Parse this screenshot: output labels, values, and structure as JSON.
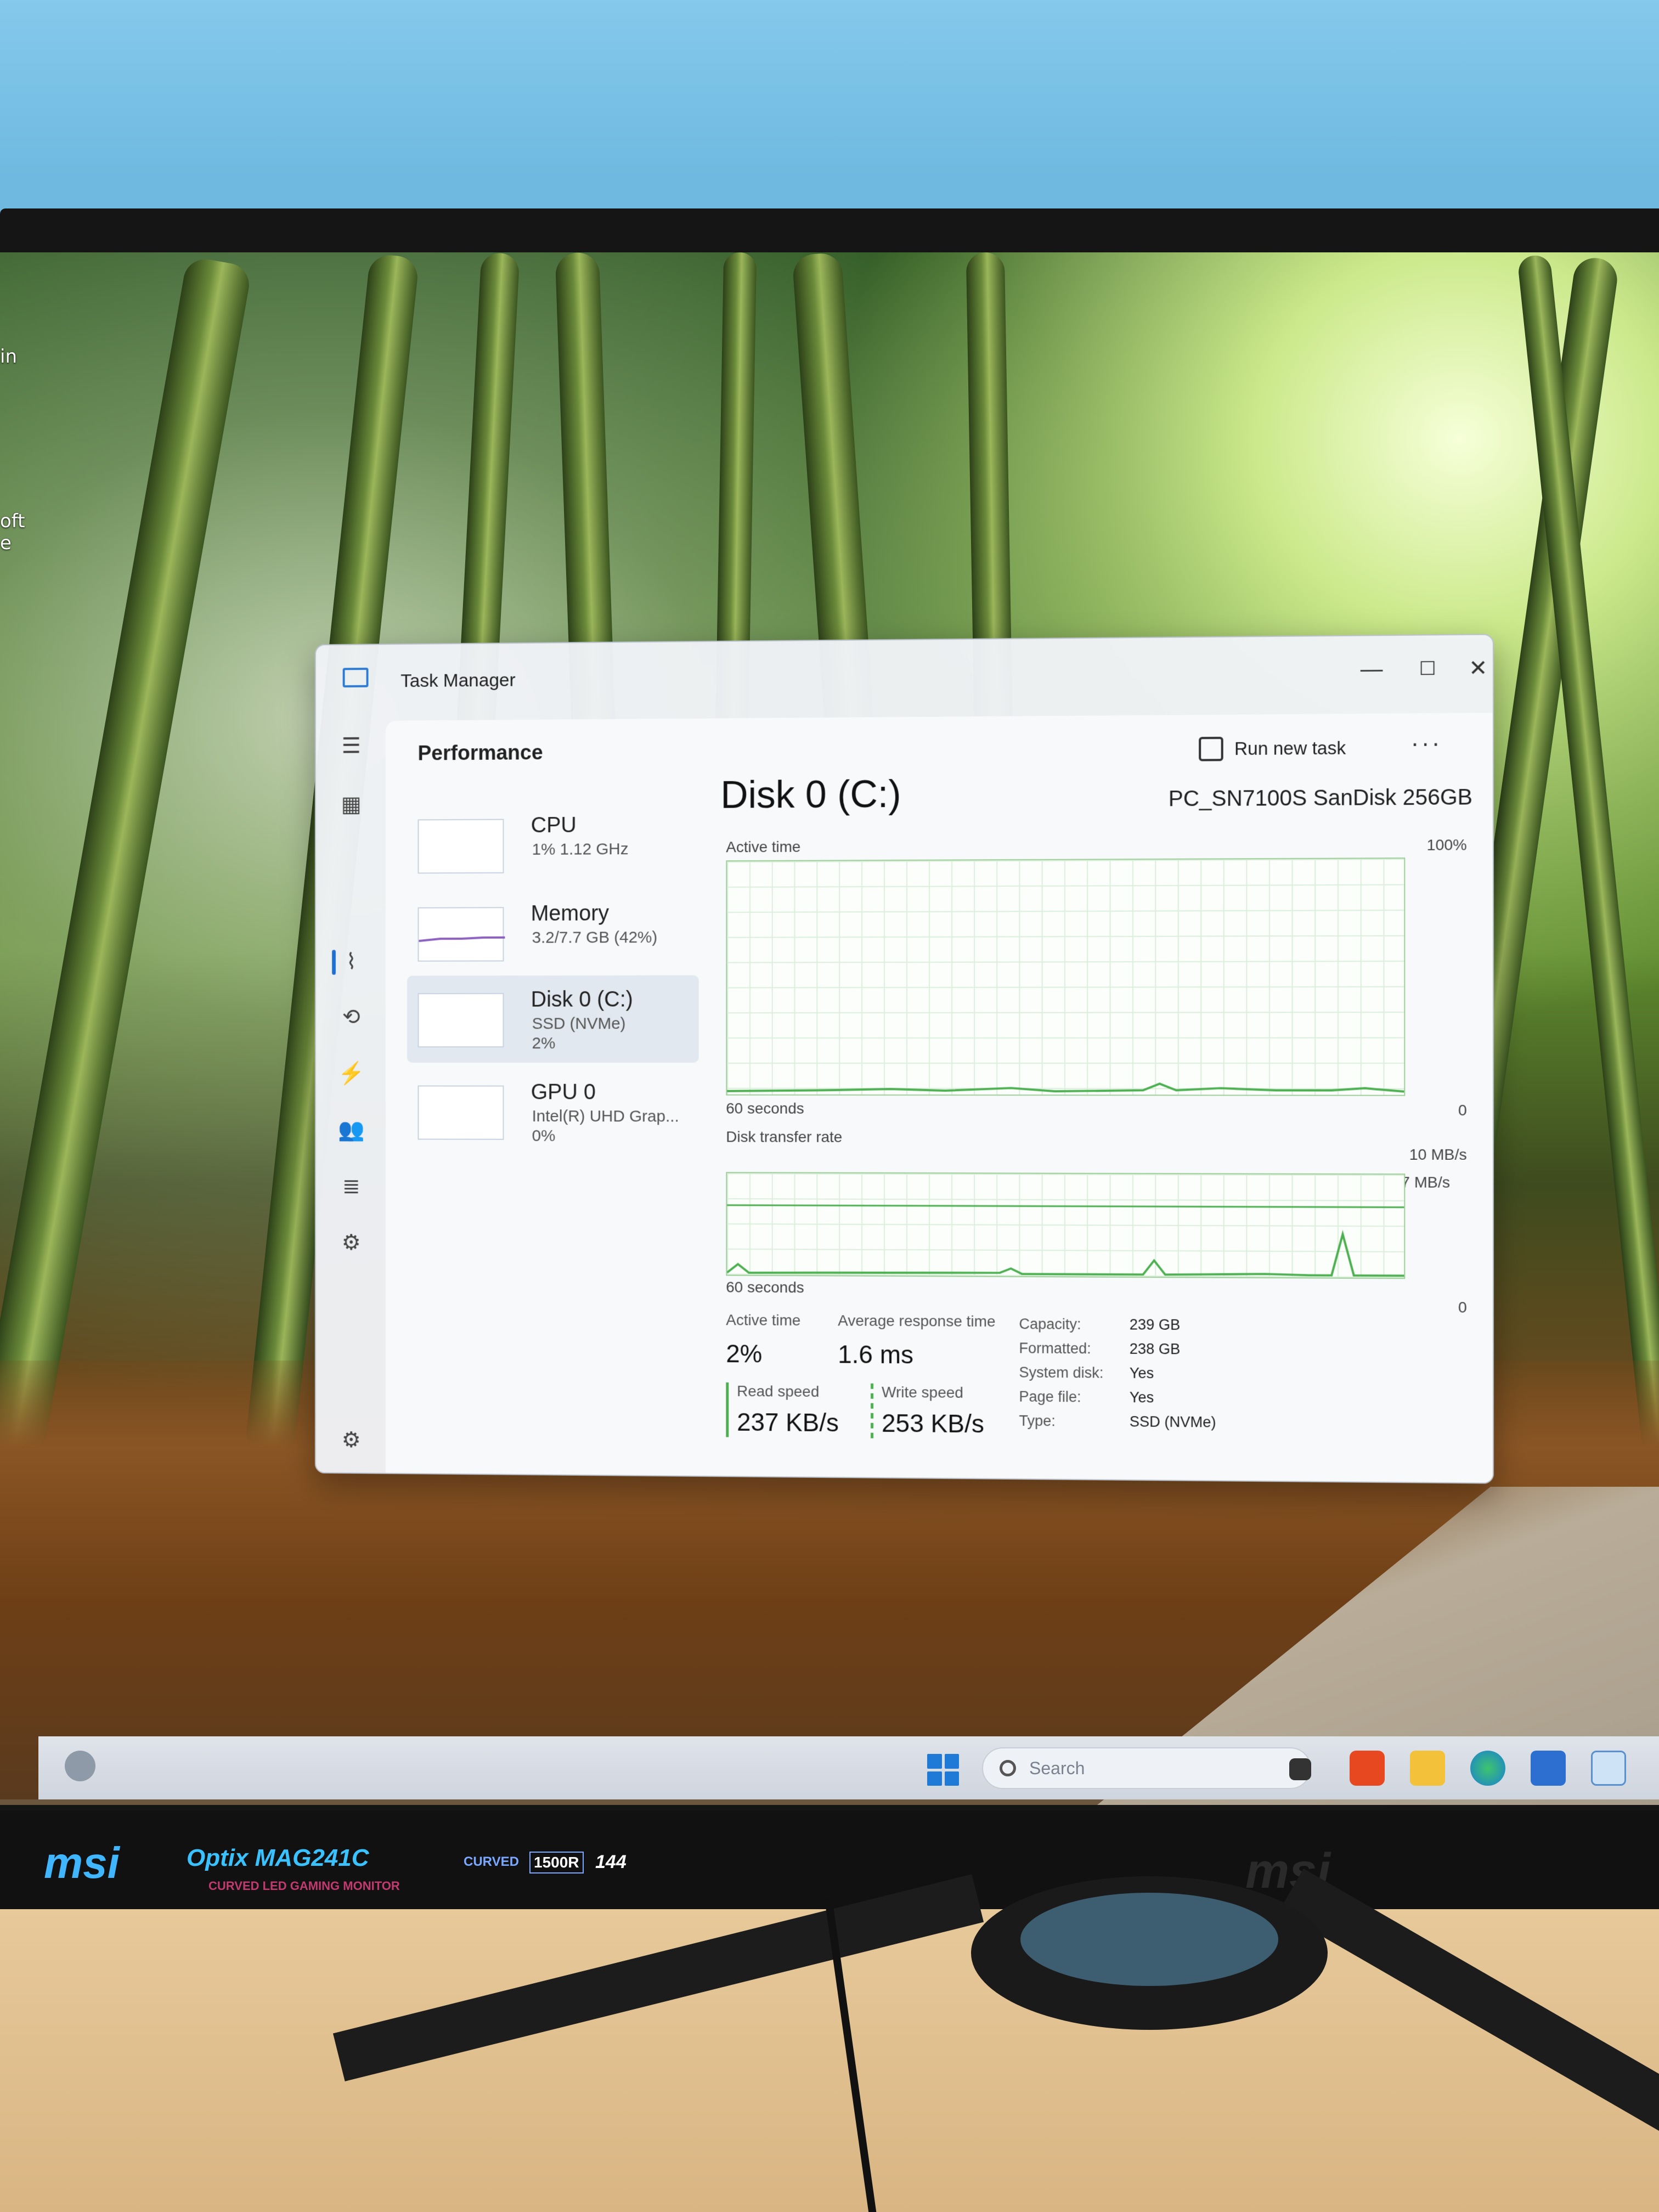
{
  "desktop": {
    "left_label_1": "in",
    "left_label_2": "oft",
    "left_label_3": "e"
  },
  "window": {
    "title": "Task Manager",
    "minimize": "—",
    "maximize": "☐",
    "close": "✕"
  },
  "toolbar": {
    "page_title": "Performance",
    "run_new_task": "Run new task",
    "more": "···"
  },
  "sidebar": {
    "items": [
      {
        "name": "CPU",
        "sub": "1% 1.12 GHz",
        "sub2": ""
      },
      {
        "name": "Memory",
        "sub": "3.2/7.7 GB (42%)",
        "sub2": ""
      },
      {
        "name": "Disk 0 (C:)",
        "sub": "SSD (NVMe)",
        "sub2": "2%"
      },
      {
        "name": "GPU 0",
        "sub": "Intel(R) UHD Grap...",
        "sub2": "0%"
      }
    ]
  },
  "detail": {
    "title": "Disk 0 (C:)",
    "model": "PC_SN7100S SanDisk 256GB",
    "graph1": {
      "label": "Active time",
      "max": "100%",
      "time": "60 seconds",
      "min": "0"
    },
    "graph2": {
      "label": "Disk transfer rate",
      "max": "10 MB/s",
      "line": "7 MB/s",
      "time": "60 seconds",
      "min": "0"
    },
    "stats": {
      "active_time_label": "Active time",
      "active_time": "2%",
      "avg_response_label": "Average response time",
      "avg_response": "1.6 ms",
      "read_label": "Read speed",
      "read": "237 KB/s",
      "write_label": "Write speed",
      "write": "253 KB/s"
    },
    "props": [
      {
        "k": "Capacity:",
        "v": "239 GB"
      },
      {
        "k": "Formatted:",
        "v": "238 GB"
      },
      {
        "k": "System disk:",
        "v": "Yes"
      },
      {
        "k": "Page file:",
        "v": "Yes"
      },
      {
        "k": "Type:",
        "v": "SSD (NVMe)"
      }
    ]
  },
  "taskbar": {
    "search_placeholder": "Search"
  },
  "monitor": {
    "brand": "msi",
    "model": "Optix MAG241C",
    "tagline": "CURVED LED GAMING MONITOR",
    "badge_1500r": "1500R",
    "badge_144": "144",
    "badge_curved": "CURVED"
  },
  "colors": {
    "accent": "#1f6fd1",
    "disk_green": "#4caf50"
  }
}
